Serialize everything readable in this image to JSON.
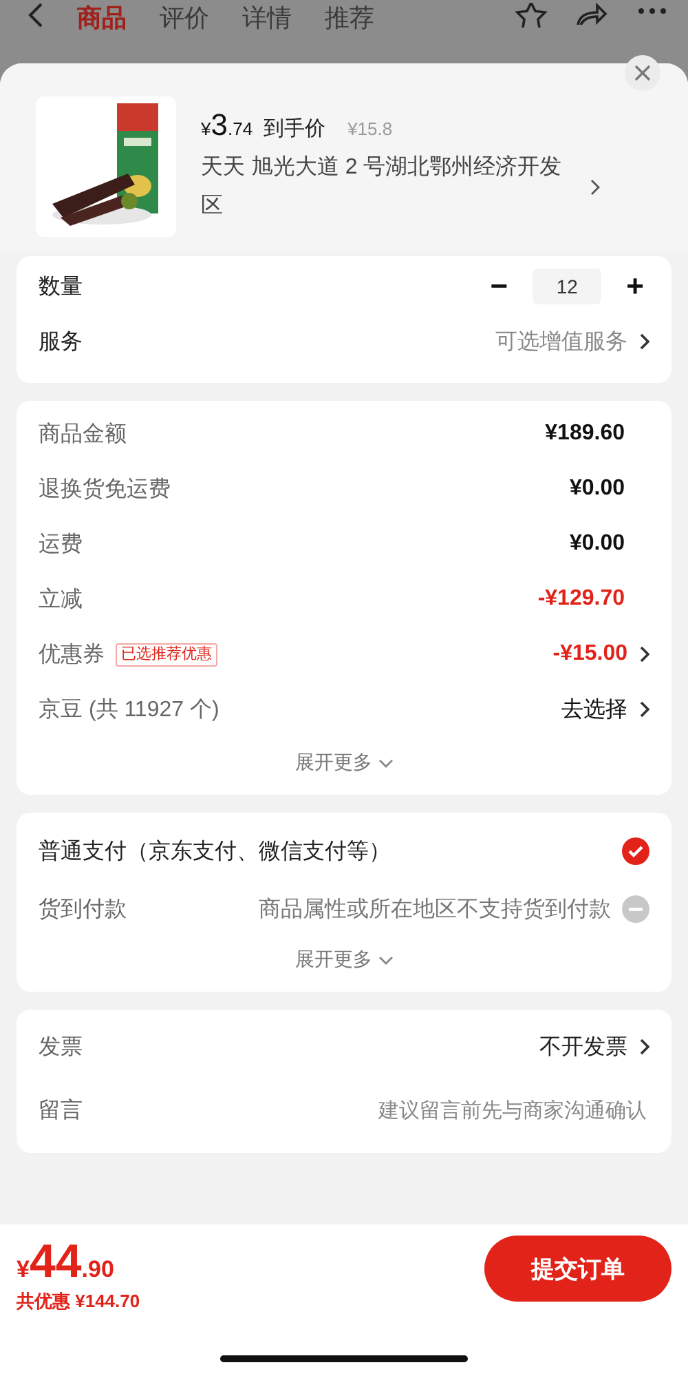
{
  "nav": {
    "tabs": [
      {
        "label": "商品",
        "selected": true
      },
      {
        "label": "评价",
        "selected": false
      },
      {
        "label": "详情",
        "selected": false
      },
      {
        "label": "推荐",
        "selected": false
      }
    ]
  },
  "product": {
    "price_symbol": "¥",
    "price_int": "3",
    "price_dec": ".74",
    "price_label": "到手价",
    "original_price": "¥15.8",
    "address": "天天  旭光大道 2 号湖北鄂州经济开发区"
  },
  "quantity": {
    "label": "数量",
    "value": "12",
    "minus": "−",
    "plus": "+"
  },
  "service": {
    "label": "服务",
    "value": "可选增值服务"
  },
  "fees": [
    {
      "label": "商品金额",
      "value": "¥189.60",
      "discount": false,
      "arrow": false
    },
    {
      "label": "退换货免运费",
      "value": "¥0.00",
      "discount": false,
      "arrow": false
    },
    {
      "label": "运费",
      "value": "¥0.00",
      "discount": false,
      "arrow": false
    },
    {
      "label": "立减",
      "value": "-¥129.70",
      "discount": true,
      "arrow": false
    },
    {
      "label": "优惠券",
      "tag": "已选推荐优惠",
      "value": "-¥15.00",
      "discount": true,
      "arrow": true
    },
    {
      "label": "京豆 (共 11927 个)",
      "value": "去选择",
      "discount": false,
      "arrow": true,
      "kind": "action"
    }
  ],
  "fees_more": "展开更多",
  "payments": [
    {
      "label": "普通支付（京东支付、微信支付等）",
      "selected": true,
      "disabled": false
    },
    {
      "label": "货到付款",
      "note": "商品属性或所在地区不支持货到付款",
      "selected": false,
      "disabled": true
    }
  ],
  "payments_more": "展开更多",
  "extras": [
    {
      "label": "发票",
      "value": "不开发票",
      "kind": "select"
    },
    {
      "label": "留言",
      "placeholder": "建议留言前先与商家沟通确认",
      "kind": "input"
    }
  ],
  "footer": {
    "symbol": "¥",
    "total_int": "44",
    "total_dec": ".90",
    "saved": "共优惠 ¥144.70",
    "submit": "提交订单"
  }
}
